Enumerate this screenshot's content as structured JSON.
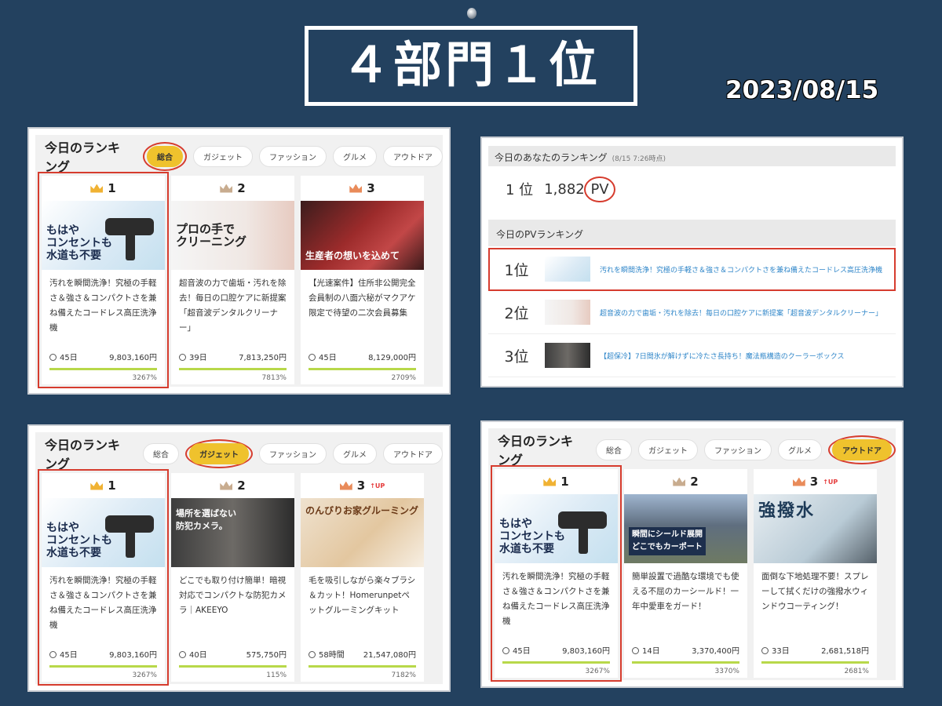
{
  "headline": "４部門１位",
  "date": "2023/08/15",
  "tabs": [
    "総合",
    "ガジェット",
    "ファッション",
    "グルメ",
    "アウトドア"
  ],
  "ranking_title": "今日のランキング",
  "panels": [
    {
      "active_tab": "総合",
      "cards": [
        {
          "rank": "1",
          "up": "",
          "thumb_caption": "もはや\nコンセントも\n水道も不要",
          "desc": "汚れを瞬間洗浄！究極の手軽さ＆強さ＆コンパクトさを兼ね備えたコードレス高圧洗浄機",
          "days": "45日",
          "amount": "9,803,160円",
          "percent": "3267%"
        },
        {
          "rank": "2",
          "up": "",
          "thumb_caption": "プロの手で\nクリーニング",
          "desc": "超音波の力で歯垢・汚れを除去！毎日の口腔ケアに新提案「超音波デンタルクリーナー」",
          "days": "39日",
          "amount": "7,813,250円",
          "percent": "7813%"
        },
        {
          "rank": "3",
          "up": "",
          "thumb_caption": "生産者の想いを込めて",
          "desc": "【光速案件】住所非公開完全会員制の八面六秘がマクアケ限定で待望の二次会員募集",
          "days": "45日",
          "amount": "8,129,000円",
          "percent": "2709%"
        }
      ]
    },
    {
      "active_tab": "ガジェット",
      "cards": [
        {
          "rank": "1",
          "up": "",
          "thumb_caption": "もはや\nコンセントも\n水道も不要",
          "desc": "汚れを瞬間洗浄！究極の手軽さ＆強さ＆コンパクトさを兼ね備えたコードレス高圧洗浄機",
          "days": "45日",
          "amount": "9,803,160円",
          "percent": "3267%"
        },
        {
          "rank": "2",
          "up": "",
          "thumb_caption": "場所を選ばない\n防犯カメラ。",
          "desc": "どこでも取り付け簡単！暗視対応でコンパクトな防犯カメラ｜AKEEYO",
          "days": "40日",
          "amount": "575,750円",
          "percent": "115%"
        },
        {
          "rank": "3",
          "up": "↑UP",
          "thumb_caption": "のんびりお家グルーミング",
          "desc": "毛を吸引しながら楽々ブラシ＆カット！Homerunpetペットグルーミングキット",
          "days": "58時間",
          "amount": "21,547,080円",
          "percent": "7182%"
        }
      ]
    },
    {
      "active_tab": "アウトドア",
      "cards": [
        {
          "rank": "1",
          "up": "",
          "thumb_caption": "もはや\nコンセントも\n水道も不要",
          "desc": "汚れを瞬間洗浄！究極の手軽さ＆強さ＆コンパクトさを兼ね備えたコードレス高圧洗浄機",
          "days": "45日",
          "amount": "9,803,160円",
          "percent": "3267%"
        },
        {
          "rank": "2",
          "up": "",
          "thumb_caption": "瞬間にシールド展開\nどこでもカーポート",
          "desc": "簡単設置で過酷な環境でも使える不屈のカーシールド！一年中愛車をガード！",
          "days": "14日",
          "amount": "3,370,400円",
          "percent": "3370%"
        },
        {
          "rank": "3",
          "up": "↑UP",
          "thumb_caption": "強撥水",
          "desc": "面倒な下地処理不要！スプレーして拭くだけの強撥水ウィンドウコーティング！",
          "days": "33日",
          "amount": "2,681,518円",
          "percent": "2681%"
        }
      ]
    }
  ],
  "pv": {
    "title": "今日のあなたのランキング",
    "time": "(8/15 7:26時点)",
    "rank": "1 位",
    "count": "1,882",
    "unit": "PV",
    "sub_title": "今日のPVランキング",
    "rows": [
      {
        "rank": "1位",
        "text": "汚れを瞬間洗浄！究極の手軽さ＆強さ＆コンパクトさを兼ね備えたコードレス高圧洗浄機"
      },
      {
        "rank": "2位",
        "text": "超音波の力で歯垢・汚れを除去！毎日の口腔ケアに新提案「超音波デンタルクリーナー」"
      },
      {
        "rank": "3位",
        "text": "【超保冷】7日間氷が解けずに冷たさ長持ち！魔法瓶構造のクーラーボックス"
      }
    ]
  },
  "colors": {
    "background": "#23415f",
    "accent_yellow": "#efc22d",
    "highlight_red": "#d63c2e",
    "progress_green": "#b8d84a",
    "link_blue": "#2f86c9"
  }
}
